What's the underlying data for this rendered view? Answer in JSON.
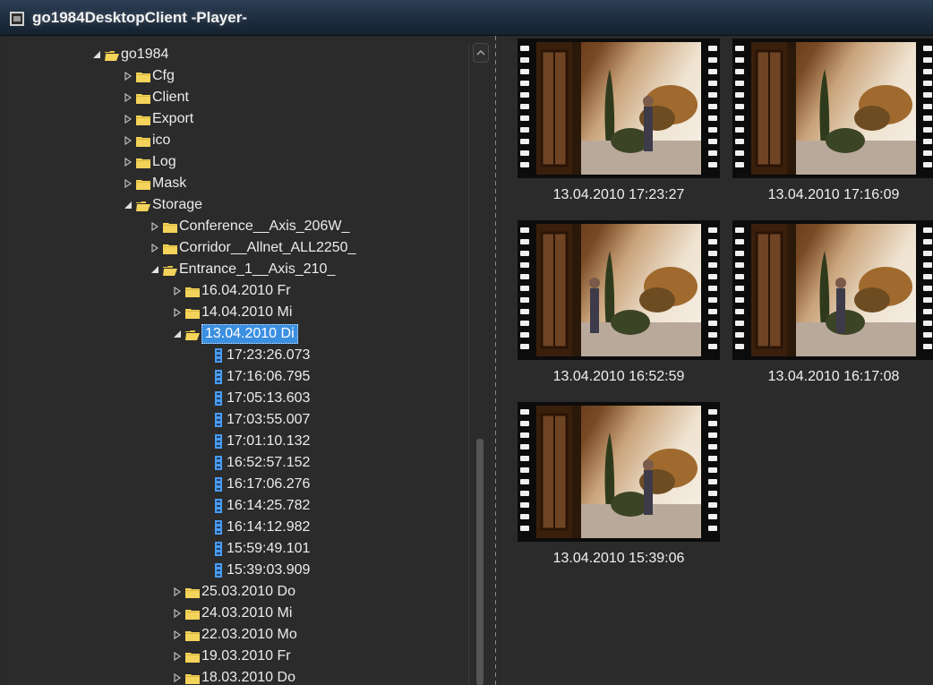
{
  "window": {
    "title": "go1984DesktopClient -Player-"
  },
  "tree": {
    "items": [
      {
        "label": "go1984",
        "type": "folder",
        "level": 0,
        "expanded": true
      },
      {
        "label": "Cfg",
        "type": "folder",
        "level": 1,
        "expanded": false
      },
      {
        "label": "Client",
        "type": "folder",
        "level": 1,
        "expanded": false
      },
      {
        "label": "Export",
        "type": "folder",
        "level": 1,
        "expanded": false
      },
      {
        "label": "ico",
        "type": "folder",
        "level": 1,
        "expanded": false
      },
      {
        "label": "Log",
        "type": "folder",
        "level": 1,
        "expanded": false
      },
      {
        "label": "Mask",
        "type": "folder",
        "level": 1,
        "expanded": false
      },
      {
        "label": "Storage",
        "type": "folder",
        "level": 1,
        "expanded": true
      },
      {
        "label": "Conference__Axis_206W_",
        "type": "folder",
        "level": 2,
        "expanded": false
      },
      {
        "label": "Corridor__Allnet_ALL2250_",
        "type": "folder",
        "level": 2,
        "expanded": false
      },
      {
        "label": "Entrance_1__Axis_210_",
        "type": "folder",
        "level": 2,
        "expanded": true
      },
      {
        "label": "16.04.2010 Fr",
        "type": "folder",
        "level": 3,
        "expanded": false
      },
      {
        "label": "14.04.2010 Mi",
        "type": "folder",
        "level": 3,
        "expanded": false
      },
      {
        "label": "13.04.2010 Di",
        "type": "folder",
        "level": 3,
        "expanded": true,
        "selected": true
      },
      {
        "label": "17:23:26.073",
        "type": "file",
        "level": 4
      },
      {
        "label": "17:16:06.795",
        "type": "file",
        "level": 4
      },
      {
        "label": "17:05:13.603",
        "type": "file",
        "level": 4
      },
      {
        "label": "17:03:55.007",
        "type": "file",
        "level": 4
      },
      {
        "label": "17:01:10.132",
        "type": "file",
        "level": 4
      },
      {
        "label": "16:52:57.152",
        "type": "file",
        "level": 4
      },
      {
        "label": "16:17:06.276",
        "type": "file",
        "level": 4
      },
      {
        "label": "16:14:25.782",
        "type": "file",
        "level": 4
      },
      {
        "label": "16:14:12.982",
        "type": "file",
        "level": 4
      },
      {
        "label": "15:59:49.101",
        "type": "file",
        "level": 4
      },
      {
        "label": "15:39:03.909",
        "type": "file",
        "level": 4
      },
      {
        "label": "25.03.2010 Do",
        "type": "folder",
        "level": 3,
        "expanded": false
      },
      {
        "label": "24.03.2010 Mi",
        "type": "folder",
        "level": 3,
        "expanded": false
      },
      {
        "label": "22.03.2010 Mo",
        "type": "folder",
        "level": 3,
        "expanded": false
      },
      {
        "label": "19.03.2010 Fr",
        "type": "folder",
        "level": 3,
        "expanded": false
      },
      {
        "label": "18.03.2010 Do",
        "type": "folder",
        "level": 3,
        "expanded": false
      }
    ]
  },
  "thumbnails": [
    {
      "caption": "13.04.2010 17:23:27"
    },
    {
      "caption": "13.04.2010 17:16:09"
    },
    {
      "caption": "13.04.2010 16:52:59"
    },
    {
      "caption": "13.04.2010 16:17:08"
    },
    {
      "caption": "13.04.2010 15:39:06"
    }
  ],
  "colors": {
    "selection": "#3b8fe0",
    "folder": "#f3d35a",
    "file": "#4a9cf2",
    "background": "#2b2b2b"
  },
  "icons": {
    "app": "film-camera-icon",
    "folder": "folder-icon",
    "file": "video-file-icon",
    "collapsed": "triangle-right-icon",
    "expanded": "triangle-down-right-icon"
  }
}
